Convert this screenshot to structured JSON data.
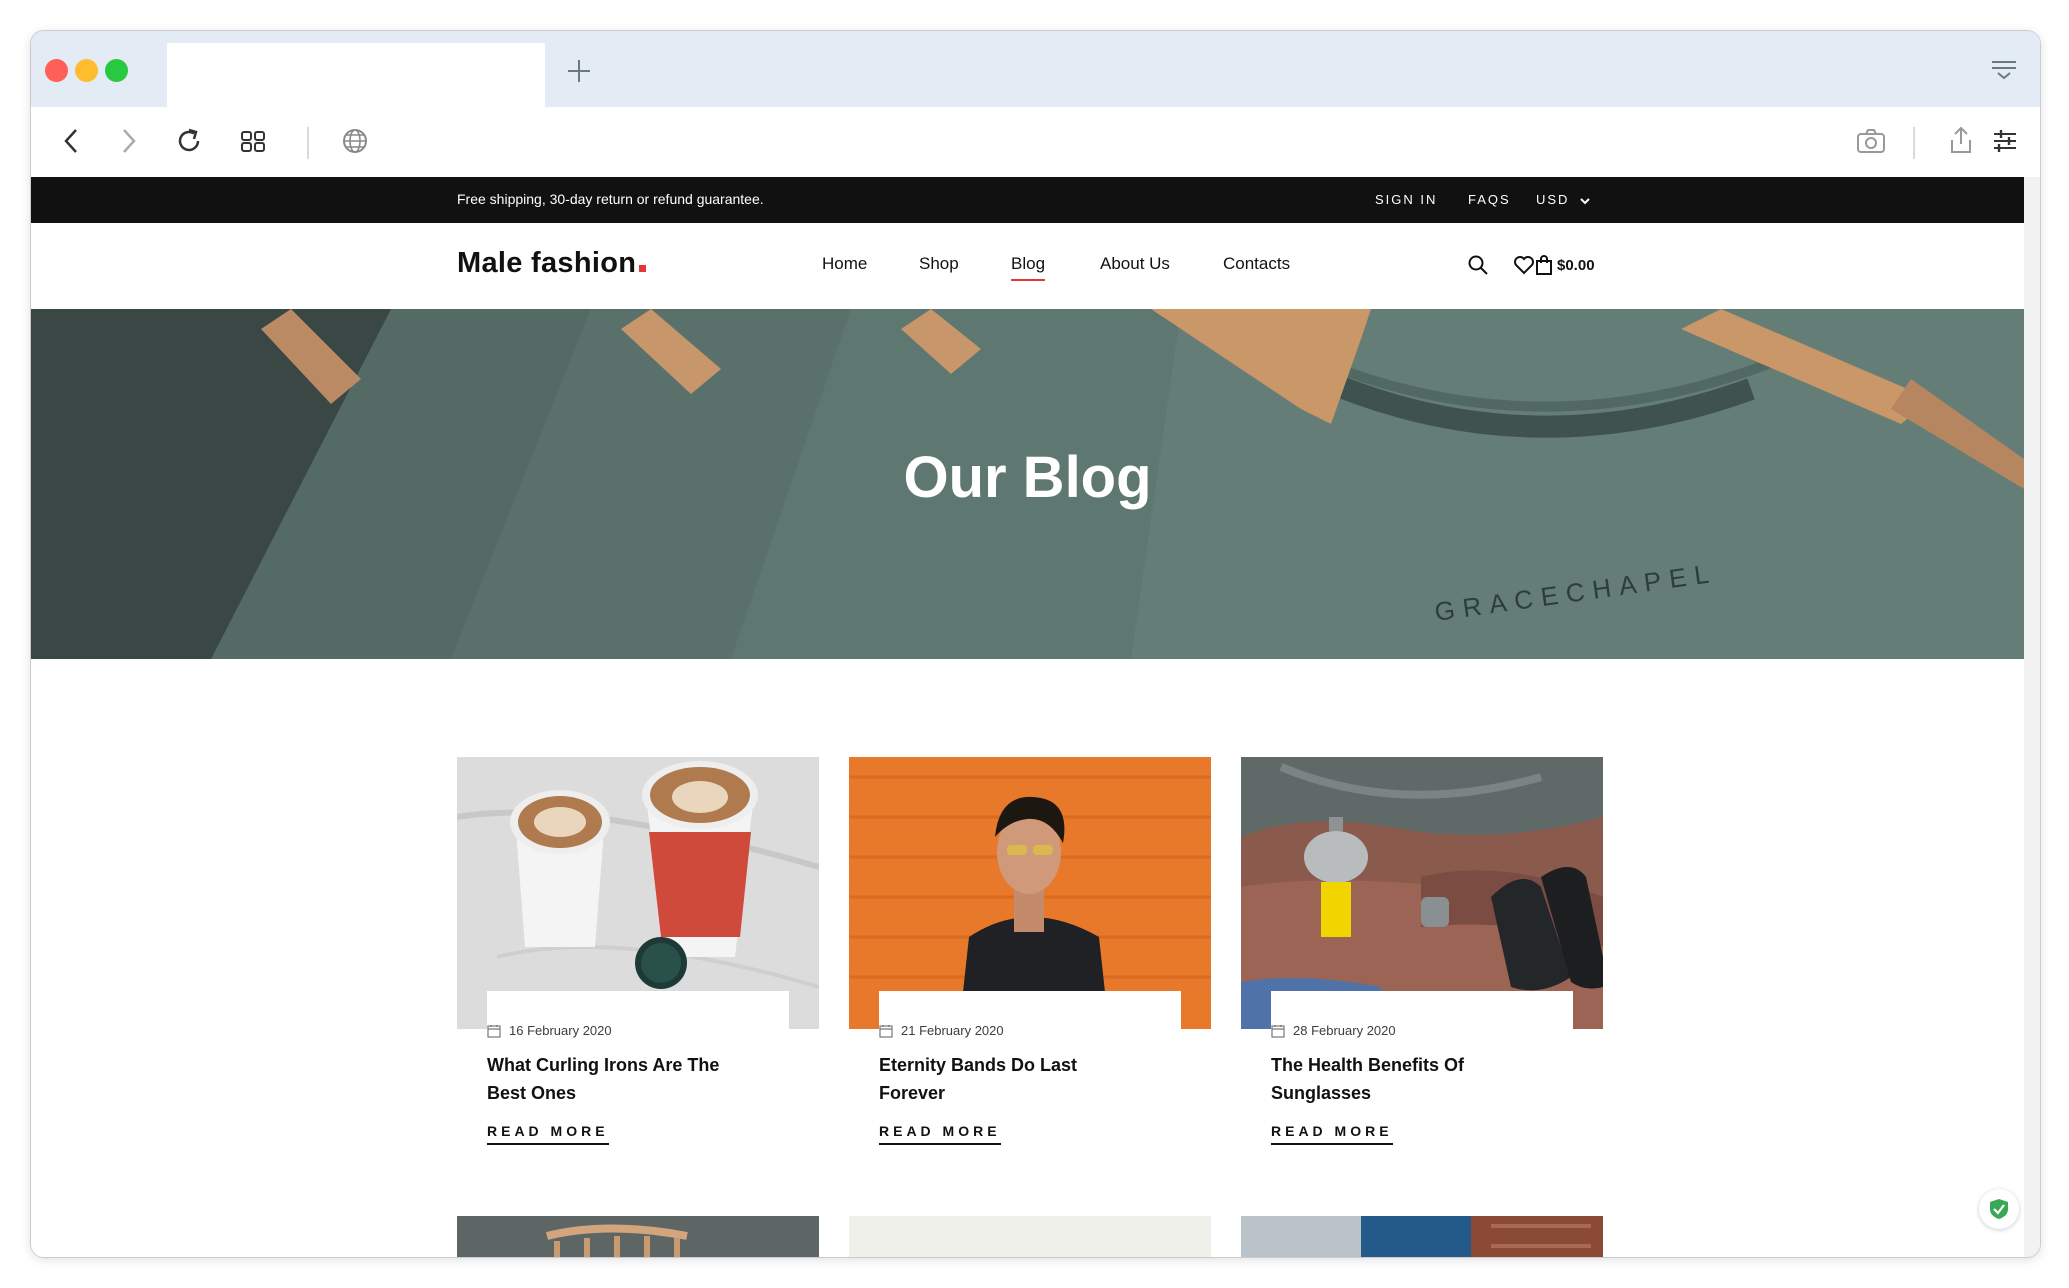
{
  "browser": {
    "new_tab_label": "+"
  },
  "topbar": {
    "promo": "Free shipping, 30-day return or refund guarantee.",
    "sign_in": "SIGN IN",
    "faqs": "FAQS",
    "currency": "USD"
  },
  "header": {
    "logo": "Male fashion",
    "nav": [
      "Home",
      "Shop",
      "Blog",
      "About Us",
      "Contacts"
    ],
    "active_nav": "Blog",
    "cart_total": "$0.00"
  },
  "hero": {
    "title": "Our Blog",
    "label_text": "GRACECHAPEL"
  },
  "posts": [
    {
      "date": "16 February 2020",
      "title": "What Curling Irons Are The Best Ones",
      "read_more": "READ MORE",
      "image": "coffee-cups"
    },
    {
      "date": "21 February 2020",
      "title": "Eternity Bands Do Last Forever",
      "read_more": "READ MORE",
      "image": "man-orange-wall"
    },
    {
      "date": "28 February 2020",
      "title": "The Health Benefits Of Sunglasses",
      "read_more": "READ MORE",
      "image": "camping-kettle"
    }
  ],
  "colors": {
    "accent": "#e53637",
    "topbar_bg": "#111111",
    "hero_bg": "#485a56"
  }
}
